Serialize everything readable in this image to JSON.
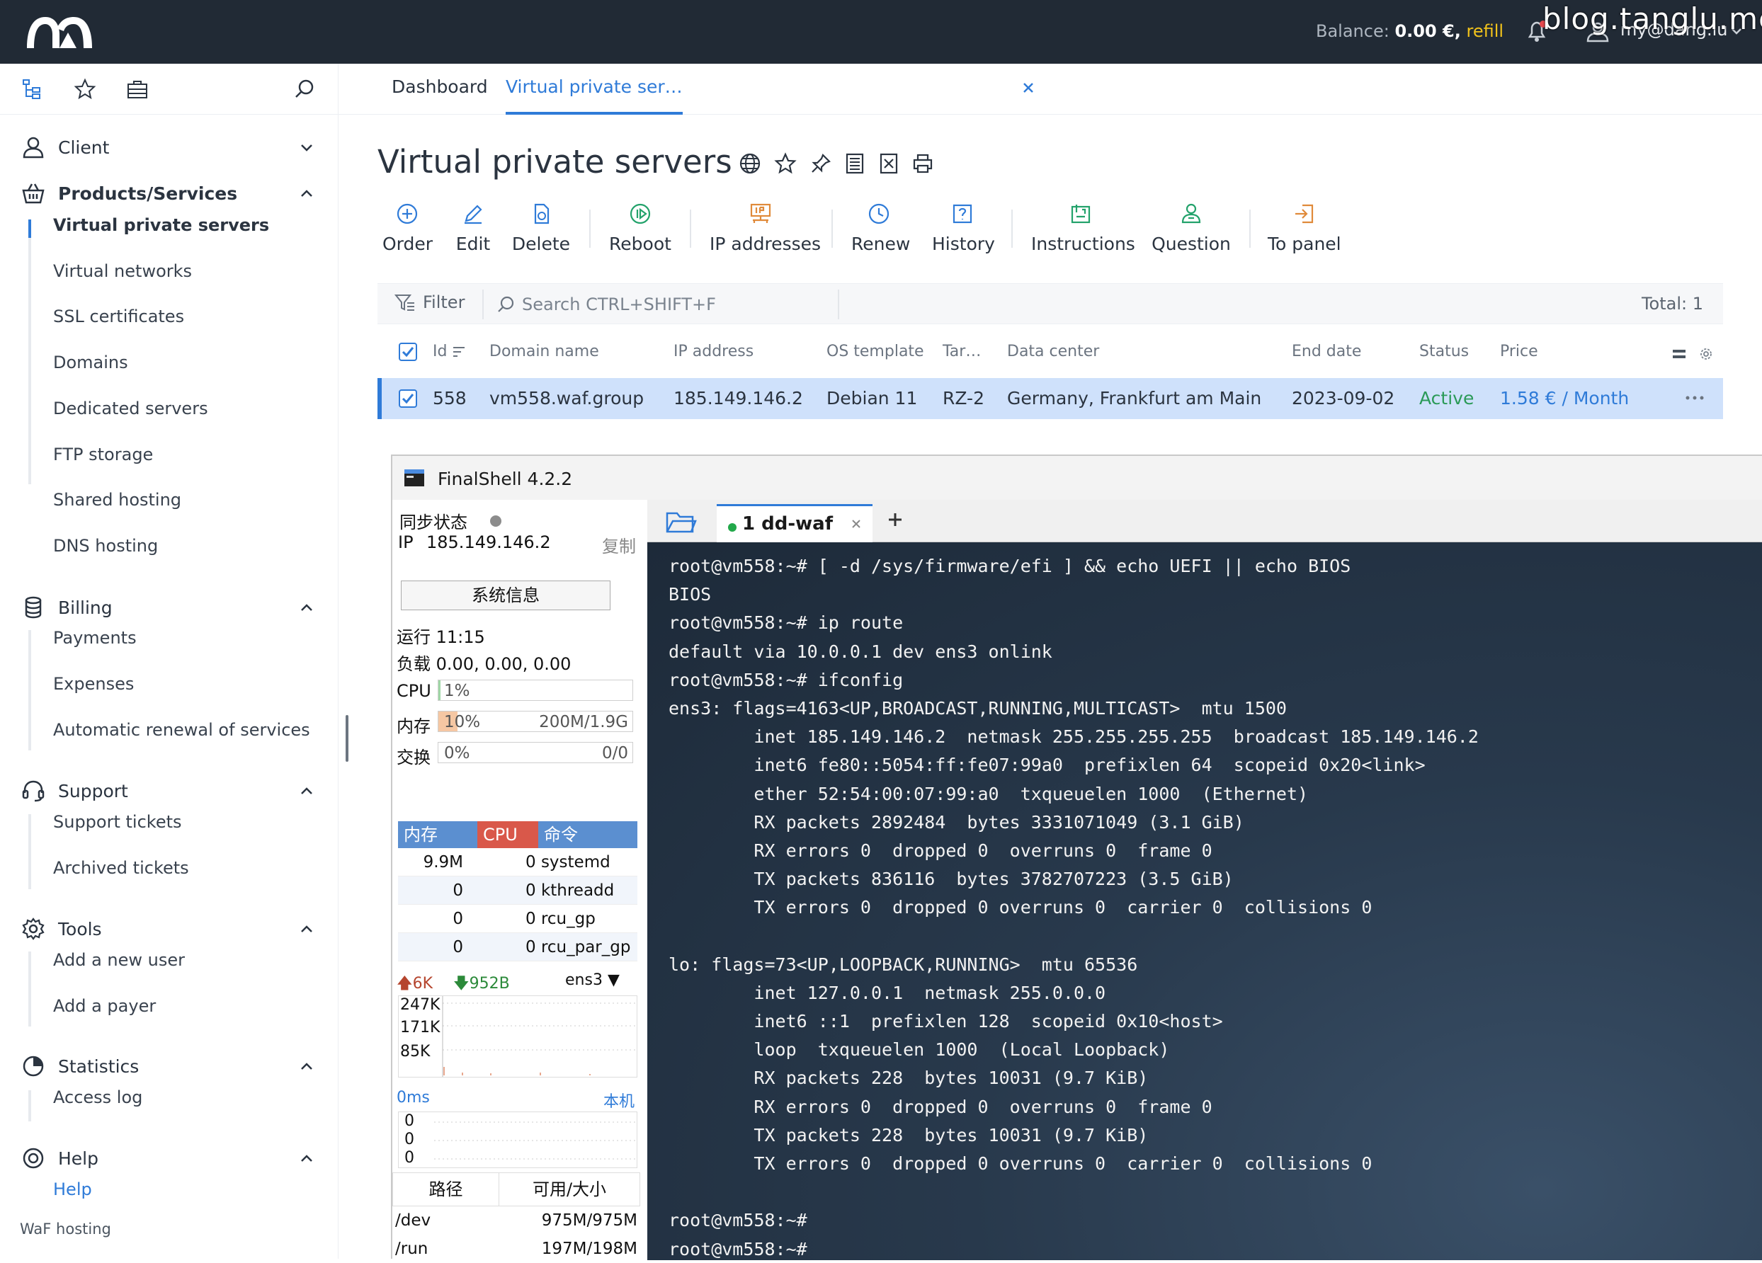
{
  "topbar": {
    "balance_label": "Balance:",
    "balance_value": "0.00 €,",
    "refill": "refill",
    "user_email": "my@dang.lu",
    "watermark": "blog.tanglu.me"
  },
  "sidebar": {
    "sections": [
      {
        "label": "Client"
      },
      {
        "label": "Products/Services",
        "items": [
          "Virtual private servers",
          "Virtual networks",
          "SSL certificates",
          "Domains",
          "Dedicated servers",
          "FTP storage",
          "Shared hosting",
          "DNS hosting"
        ]
      },
      {
        "label": "Billing",
        "items": [
          "Payments",
          "Expenses",
          "Automatic renewal of services"
        ]
      },
      {
        "label": "Support",
        "items": [
          "Support tickets",
          "Archived tickets"
        ]
      },
      {
        "label": "Tools",
        "items": [
          "Add a new user",
          "Add a payer"
        ]
      },
      {
        "label": "Statistics",
        "items": [
          "Access log"
        ]
      },
      {
        "label": "Help",
        "items": [
          "Help"
        ]
      }
    ],
    "footer": "WaF hosting"
  },
  "tabs": [
    {
      "label": "Dashboard"
    },
    {
      "label": "Virtual private ser…"
    }
  ],
  "page": {
    "title": "Virtual private servers"
  },
  "toolbar": [
    "Order",
    "Edit",
    "Delete",
    "Reboot",
    "IP addresses",
    "Renew",
    "History",
    "Instructions",
    "Question",
    "To panel"
  ],
  "filter": {
    "filter_label": "Filter",
    "search_placeholder": "Search CTRL+SHIFT+F",
    "total": "Total: 1"
  },
  "table": {
    "columns": [
      "Id",
      "Domain name",
      "IP address",
      "OS template",
      "Tar…",
      "Data center",
      "End date",
      "Status",
      "Price"
    ],
    "rows": [
      {
        "id": "558",
        "domain": "vm558.waf.group",
        "ip": "185.149.146.2",
        "os": "Debian 11",
        "tariff": "RZ-2",
        "datacenter": "Germany, Frankfurt am Main",
        "end_date": "2023-09-02",
        "status": "Active",
        "price": "1.58 € / Month"
      }
    ]
  },
  "finalshell": {
    "title": "FinalShell 4.2.2",
    "sync_status": "同步状态",
    "ip_label": "IP",
    "ip": "185.149.146.2",
    "copy": "复制",
    "sysinfo": "系统信息",
    "uptime": "运行 11:15",
    "load": "负载 0.00, 0.00, 0.00",
    "cpu": {
      "label": "CPU",
      "text": "1%",
      "fraction": 0.01
    },
    "mem": {
      "label": "内存",
      "text": "10%",
      "right": "200M/1.9G",
      "fraction": 0.1
    },
    "swap": {
      "label": "交换",
      "text": "0%",
      "right": "0/0",
      "fraction": 0.0
    },
    "proc_headers": [
      "内存",
      "CPU",
      "命令"
    ],
    "processes": [
      {
        "mem": "9.9M",
        "cmd": "0 systemd"
      },
      {
        "mem": "0",
        "cmd": "0 kthreadd"
      },
      {
        "mem": "0",
        "cmd": "0 rcu_gp"
      },
      {
        "mem": "0",
        "cmd": "0 rcu_par_gp"
      }
    ],
    "net": {
      "up": "6K",
      "down": "952B",
      "iface": "ens3",
      "scale": [
        "247K",
        "171K",
        "85K"
      ]
    },
    "ping": {
      "latency": "0ms",
      "target": "本机",
      "values": [
        "0",
        "0",
        "0"
      ]
    },
    "disk_headers": [
      "路径",
      "可用/大小"
    ],
    "disks": [
      {
        "path": "/dev",
        "size": "975M/975M"
      },
      {
        "path": "/run",
        "size": "197M/198M"
      }
    ],
    "session_tab": "1 dd-waf",
    "terminal_lines": [
      "root@vm558:~# [ -d /sys/firmware/efi ] && echo UEFI || echo BIOS",
      "BIOS",
      "root@vm558:~# ip route",
      "default via 10.0.0.1 dev ens3 onlink",
      "root@vm558:~# ifconfig",
      "ens3: flags=4163<UP,BROADCAST,RUNNING,MULTICAST>  mtu 1500",
      "        inet 185.149.146.2  netmask 255.255.255.255  broadcast 185.149.146.2",
      "        inet6 fe80::5054:ff:fe07:99a0  prefixlen 64  scopeid 0x20<link>",
      "        ether 52:54:00:07:99:a0  txqueuelen 1000  (Ethernet)",
      "        RX packets 2892484  bytes 3331071049 (3.1 GiB)",
      "        RX errors 0  dropped 0  overruns 0  frame 0",
      "        TX packets 836116  bytes 3782707223 (3.5 GiB)",
      "        TX errors 0  dropped 0 overruns 0  carrier 0  collisions 0",
      "",
      "lo: flags=73<UP,LOOPBACK,RUNNING>  mtu 65536",
      "        inet 127.0.0.1  netmask 255.0.0.0",
      "        inet6 ::1  prefixlen 128  scopeid 0x10<host>",
      "        loop  txqueuelen 1000  (Local Loopback)",
      "        RX packets 228  bytes 10031 (9.7 KiB)",
      "        RX errors 0  dropped 0  overruns 0  frame 0",
      "        TX packets 228  bytes 10031 (9.7 KiB)",
      "        TX errors 0  dropped 0 overruns 0  carrier 0  collisions 0",
      "",
      "root@vm558:~#",
      "root@vm558:~#"
    ]
  },
  "colors": {
    "topbar": "#212a35",
    "accent": "#2f7bd8",
    "selected_row": "#cfe1fb",
    "status_active": "#2b9a58",
    "refill": "#f1c21b"
  }
}
